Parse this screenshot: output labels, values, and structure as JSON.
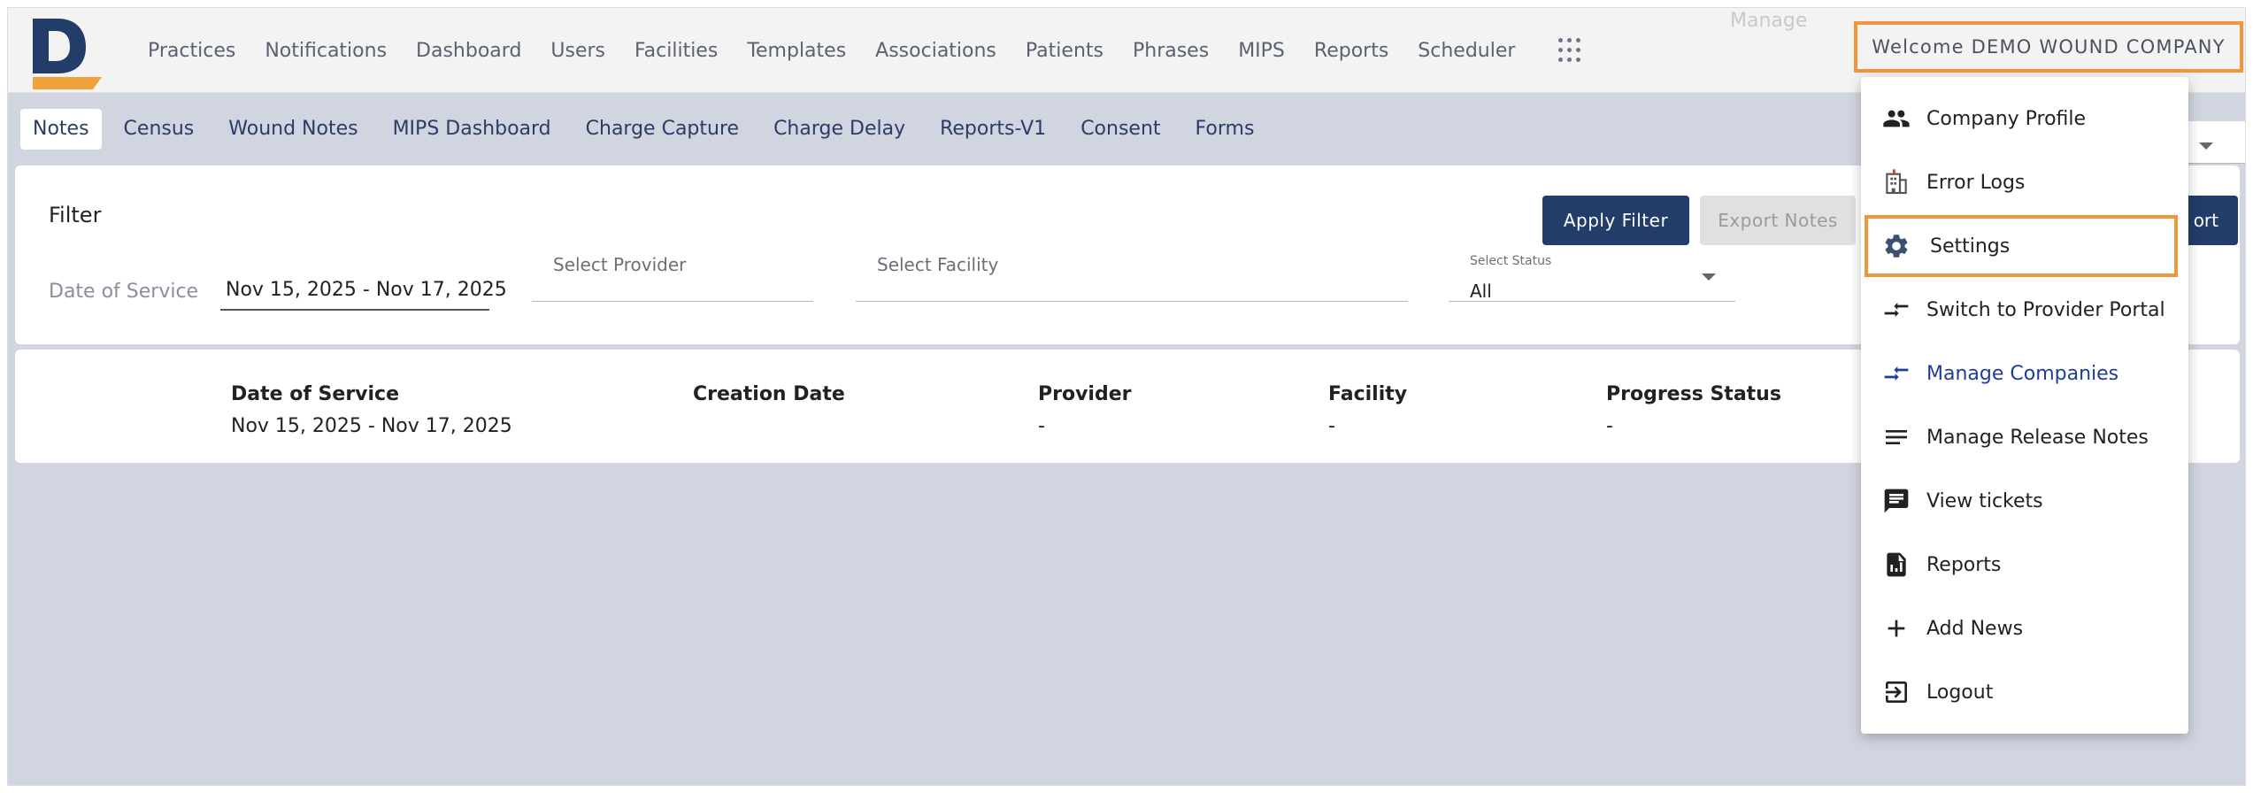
{
  "topnav": {
    "items": [
      "Practices",
      "Notifications",
      "Dashboard",
      "Users",
      "Facilities",
      "Templates",
      "Associations",
      "Patients",
      "Phrases",
      "MIPS",
      "Reports",
      "Scheduler"
    ],
    "welcome": "Welcome DEMO WOUND COMPANY",
    "ghost_text": "Manage"
  },
  "subtabs": [
    "Notes",
    "Census",
    "Wound Notes",
    "MIPS Dashboard",
    "Charge Capture",
    "Charge Delay",
    "Reports-V1",
    "Consent",
    "Forms"
  ],
  "filter": {
    "title": "Filter",
    "apply_label": "Apply Filter",
    "export_label": "Export Notes",
    "report_label": "ort",
    "dos_label": "Date of Service",
    "dos_value": "Nov 15, 2025 - Nov 17, 2025",
    "provider_placeholder": "Select Provider",
    "facility_placeholder": "Select Facility",
    "status_label": "Select Status",
    "status_value": "All"
  },
  "table": {
    "headers": [
      "Date of Service",
      "Creation Date",
      "Provider",
      "Facility",
      "Progress Status"
    ],
    "row": [
      "Nov 15, 2025 - Nov 17, 2025",
      "",
      "-",
      "-",
      "-"
    ]
  },
  "menu": {
    "items": [
      {
        "label": "Company Profile",
        "icon": "people-icon"
      },
      {
        "label": "Error Logs",
        "icon": "building-icon"
      },
      {
        "label": "Settings",
        "icon": "gear-icon"
      },
      {
        "label": "Switch to Provider Portal",
        "icon": "swap-arrows-icon"
      },
      {
        "label": "Manage Companies",
        "icon": "swap-arrows-icon"
      },
      {
        "label": "Manage Release Notes",
        "icon": "notes-lines-icon"
      },
      {
        "label": "View tickets",
        "icon": "chat-bubble-icon"
      },
      {
        "label": "Reports",
        "icon": "report-document-icon"
      },
      {
        "label": "Add News",
        "icon": "plus-icon"
      },
      {
        "label": "Logout",
        "icon": "logout-icon"
      }
    ]
  },
  "colors": {
    "accent_orange": "#f0963a",
    "primary_navy": "#233d6a",
    "link_blue": "#1f3c98",
    "background": "#d1d5e0"
  }
}
